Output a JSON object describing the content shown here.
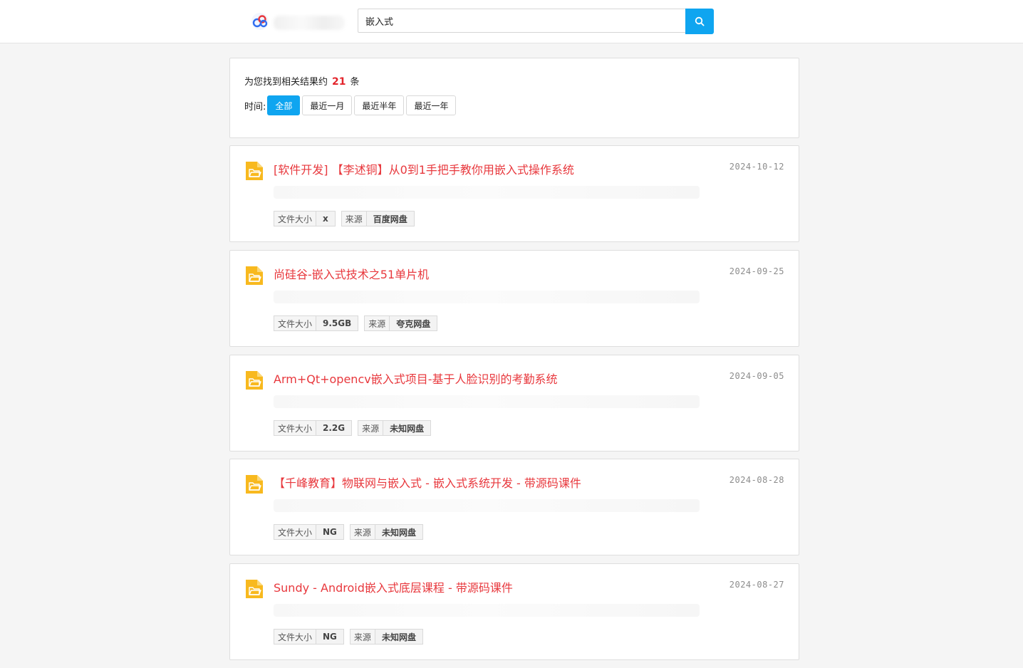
{
  "search": {
    "query": "嵌入式"
  },
  "summary": {
    "prefix": "为您找到相关结果约",
    "count": "21",
    "suffix": "条"
  },
  "filters": {
    "label": "时间:",
    "options": [
      "全部",
      "最近一月",
      "最近半年",
      "最近一年"
    ],
    "selected": "全部"
  },
  "tag_labels": {
    "size": "文件大小",
    "source": "来源"
  },
  "results": [
    {
      "title": "[软件开发] 【李述铜】从0到1手把手教你用嵌入式操作系统",
      "date": "2024-10-12",
      "size": "x",
      "source": "百度网盘"
    },
    {
      "title": "尚硅谷-嵌入式技术之51单片机",
      "date": "2024-09-25",
      "size": "9.5GB",
      "source": "夸克网盘"
    },
    {
      "title": "Arm+Qt+opencv嵌入式项目-基于人脸识别的考勤系统",
      "date": "2024-09-05",
      "size": "2.2G",
      "source": "未知网盘"
    },
    {
      "title": "【千峰教育】物联网与嵌入式 - 嵌入式系统开发 - 带源码课件",
      "date": "2024-08-28",
      "size": "NG",
      "source": "未知网盘"
    },
    {
      "title": "Sundy - Android嵌入式底层课程 - 带源码课件",
      "date": "2024-08-27",
      "size": "NG",
      "source": "未知网盘"
    }
  ],
  "colors": {
    "accent": "#0fa5f0",
    "title_red": "#e8383d",
    "count_red": "#e3242b",
    "folder": "#f8b91e"
  },
  "icons": {
    "logo": "cloud-logo-icon",
    "search": "search-icon",
    "file": "folder-icon"
  }
}
